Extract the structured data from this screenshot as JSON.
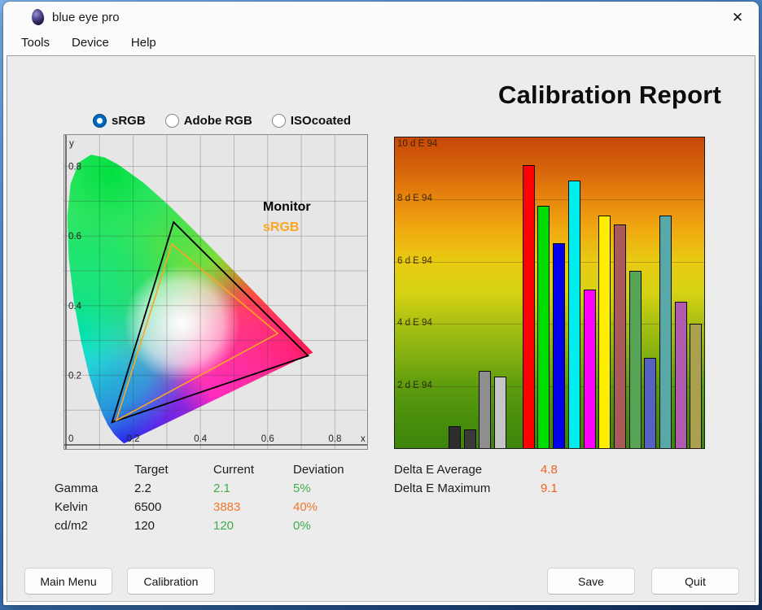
{
  "window": {
    "title": "blue eye pro",
    "close_glyph": "✕"
  },
  "menu": {
    "items": [
      "Tools",
      "Device",
      "Help"
    ]
  },
  "report_title": "Calibration Report",
  "profile_selector": {
    "options": [
      {
        "label": "sRGB",
        "selected": true
      },
      {
        "label": "Adobe RGB",
        "selected": false
      },
      {
        "label": "ISOcoated",
        "selected": false
      }
    ]
  },
  "cie_diagram": {
    "x_axis_label": "x",
    "y_axis_label": "y",
    "origin_label": "0",
    "x_ticks": [
      {
        "value": 0.2,
        "label": "0.2"
      },
      {
        "value": 0.4,
        "label": "0.4"
      },
      {
        "value": 0.6,
        "label": "0.6"
      },
      {
        "value": 0.8,
        "label": "0.8"
      }
    ],
    "y_ticks": [
      {
        "value": 0.2,
        "label": "0.2"
      },
      {
        "value": 0.4,
        "label": "0.4"
      },
      {
        "value": 0.6,
        "label": "0.6"
      },
      {
        "value": 0.8,
        "label": "0.8"
      }
    ],
    "legend": [
      {
        "label": "Monitor",
        "color": "#000000"
      },
      {
        "label": "sRGB",
        "color": "#ffa423"
      }
    ],
    "gamut_triangles": [
      {
        "name": "Monitor",
        "color": "#000000",
        "width": 1.8,
        "points": [
          [
            0.72,
            0.256
          ],
          [
            0.32,
            0.64
          ],
          [
            0.137,
            0.065
          ]
        ]
      },
      {
        "name": "sRGB",
        "color": "#ffa423",
        "width": 1.6,
        "points": [
          [
            0.63,
            0.32
          ],
          [
            0.315,
            0.577
          ],
          [
            0.15,
            0.07
          ]
        ]
      }
    ]
  },
  "chart_data": {
    "type": "bar",
    "title": "",
    "ylabel": "d E 94",
    "ylim": [
      0,
      10
    ],
    "grid": true,
    "yticks": [
      {
        "value": 10,
        "label": "10 d E 94"
      },
      {
        "value": 8,
        "label": "8 d E 94"
      },
      {
        "value": 6,
        "label": "6 d E 94"
      },
      {
        "value": 4,
        "label": "4 d E 94"
      },
      {
        "value": 2,
        "label": "2 d E 94"
      }
    ],
    "bars": [
      {
        "name": "black",
        "value": 0.7,
        "color": "#2d2d2d"
      },
      {
        "name": "dark-gray",
        "value": 0.6,
        "color": "#3a3a3a"
      },
      {
        "name": "gray",
        "value": 2.5,
        "color": "#8e8e8e"
      },
      {
        "name": "light-gray",
        "value": 2.3,
        "color": "#c6c6c6"
      },
      {
        "name": "red",
        "value": 9.1,
        "color": "#fe0000"
      },
      {
        "name": "green",
        "value": 7.8,
        "color": "#00dd00"
      },
      {
        "name": "blue",
        "value": 6.6,
        "color": "#0000ee"
      },
      {
        "name": "cyan",
        "value": 8.6,
        "color": "#00eeee"
      },
      {
        "name": "magenta",
        "value": 5.1,
        "color": "#ff00ff"
      },
      {
        "name": "yellow",
        "value": 7.5,
        "color": "#ffee00"
      },
      {
        "name": "brown-red",
        "value": 7.2,
        "color": "#aa5a5a"
      },
      {
        "name": "mid-green",
        "value": 5.7,
        "color": "#56a456"
      },
      {
        "name": "slate-blue",
        "value": 2.9,
        "color": "#5562c2"
      },
      {
        "name": "teal",
        "value": 7.5,
        "color": "#58a8a8"
      },
      {
        "name": "purple",
        "value": 4.7,
        "color": "#b05ab0"
      },
      {
        "name": "olive",
        "value": 4.0,
        "color": "#aaa04e"
      }
    ]
  },
  "results_table": {
    "col_headers": [
      "Target",
      "Current",
      "Deviation"
    ],
    "rows": [
      {
        "label": "Gamma",
        "target": "2.2",
        "current": "2.1",
        "deviation": "5%",
        "status": "ok"
      },
      {
        "label": "Kelvin",
        "target": "6500",
        "current": "3883",
        "deviation": "40%",
        "status": "warn"
      },
      {
        "label": "cd/m2",
        "target": "120",
        "current": "120",
        "deviation": "0%",
        "status": "ok"
      }
    ]
  },
  "delta_e": {
    "rows": [
      {
        "label": "Delta E Average",
        "value": "4.8"
      },
      {
        "label": "Delta E Maximum",
        "value": "9.1"
      }
    ]
  },
  "action_buttons": {
    "main_menu": "Main Menu",
    "calibration": "Calibration",
    "save": "Save",
    "quit": "Quit"
  },
  "colors": {
    "accent": "#0067c0",
    "ok_green": "#3fae49",
    "warn_orange": "#f0762e",
    "delta_value_orange": "#ef6325",
    "srgb_legend_orange": "#ffa423"
  }
}
